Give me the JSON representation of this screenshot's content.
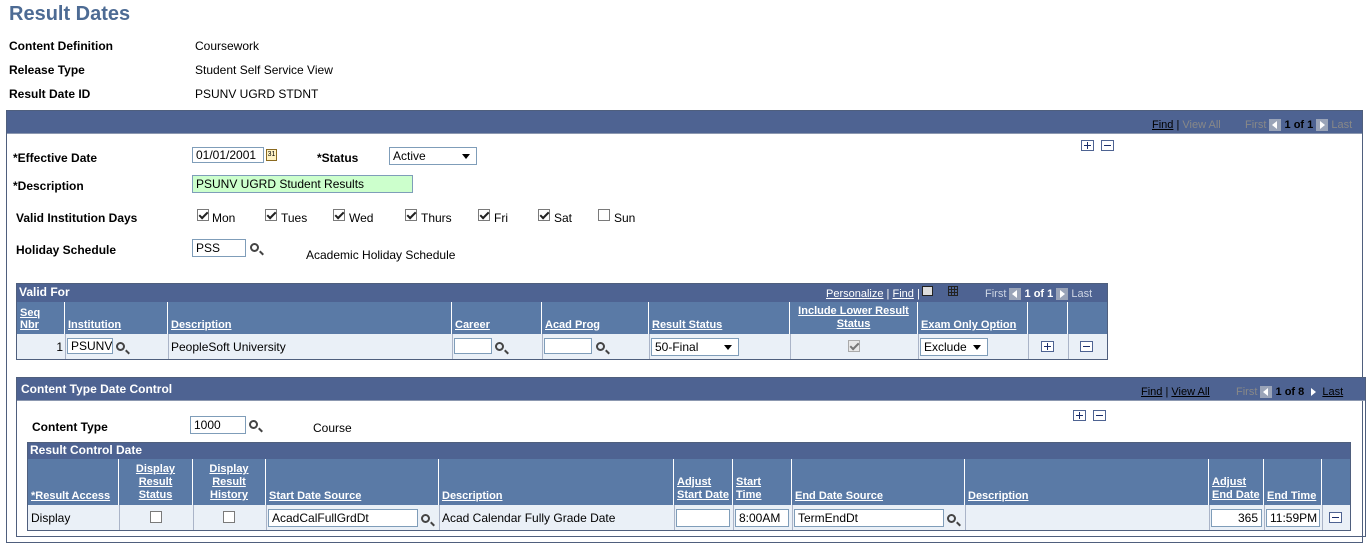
{
  "page_title": "Result Dates",
  "header_fields": [
    {
      "label": "Content Definition",
      "value": "Coursework"
    },
    {
      "label": "Release Type",
      "value": "Student Self Service View"
    },
    {
      "label": "Result Date ID",
      "value": "PSUNV UGRD STDNT"
    }
  ],
  "outer_nav": {
    "find": "Find",
    "view_all": "View All",
    "first": "First",
    "count": "1 of 1",
    "last": "Last"
  },
  "effective": {
    "effective_date_label": "*Effective Date",
    "effective_date_value": "01/01/2001",
    "status_label": "*Status",
    "status_value": "Active",
    "description_label": "*Description",
    "description_value": "PSUNV UGRD Student Results",
    "valid_days_label": "Valid Institution Days",
    "days": [
      {
        "label": "Mon",
        "checked": true
      },
      {
        "label": "Tues",
        "checked": true
      },
      {
        "label": "Wed",
        "checked": true
      },
      {
        "label": "Thurs",
        "checked": true
      },
      {
        "label": "Fri",
        "checked": true
      },
      {
        "label": "Sat",
        "checked": true
      },
      {
        "label": "Sun",
        "checked": false
      }
    ],
    "holiday_label": "Holiday Schedule",
    "holiday_value": "PSS",
    "holiday_desc": "Academic Holiday Schedule"
  },
  "valid_for": {
    "title": "Valid For",
    "nav": {
      "personalize": "Personalize",
      "find": "Find",
      "first": "First",
      "count": "1 of 1",
      "last": "Last"
    },
    "headers": {
      "seq": "Seq Nbr",
      "institution": "Institution",
      "description": "Description",
      "career": "Career",
      "acad_prog": "Acad Prog",
      "result_status": "Result Status",
      "include_lower": "Include Lower Result Status",
      "exam_only": "Exam Only Option"
    },
    "row": {
      "seq": "1",
      "institution": "PSUNV",
      "description": "PeopleSoft University",
      "career": "",
      "acad_prog": "",
      "result_status": "50-Final",
      "include_lower": true,
      "exam_only": "Exclude"
    }
  },
  "content_type": {
    "title": "Content Type Date Control",
    "nav": {
      "find": "Find",
      "view_all": "View All",
      "first": "First",
      "count": "1 of 8",
      "last": "Last"
    },
    "content_type_label": "Content Type",
    "content_type_value": "1000",
    "content_type_desc": "Course",
    "rcd": {
      "title": "Result Control Date",
      "headers": {
        "result_access": "*Result Access",
        "display_status": "Display Result Status",
        "display_history": "Display Result History",
        "start_source": "Start Date Source",
        "start_desc": "Description",
        "adjust_start": "Adjust Start Date",
        "start_time": "Start Time",
        "end_source": "End Date Source",
        "end_desc": "Description",
        "adjust_end": "Adjust End Date",
        "end_time": "End Time"
      },
      "row": {
        "result_access": "Display",
        "display_status": false,
        "display_history": false,
        "start_source": "AcadCalFullGrdDt",
        "start_desc": "Acad Calendar Fully Grade Date",
        "adjust_start": "",
        "start_time": "8:00AM",
        "end_source": "TermEndDt",
        "end_desc": "",
        "adjust_end": "365",
        "end_time": "11:59PM"
      }
    }
  }
}
